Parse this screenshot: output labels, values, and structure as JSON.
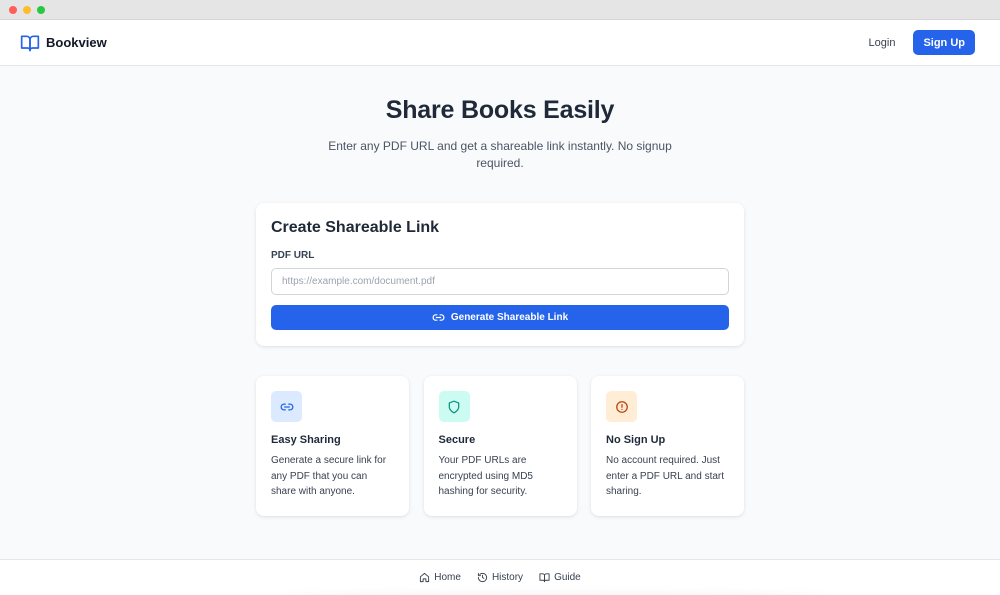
{
  "navbar": {
    "brand": "Bookview",
    "login_label": "Login",
    "signup_label": "Sign Up"
  },
  "hero": {
    "title": "Share Books Easily",
    "subtitle": "Enter any PDF URL and get a shareable link instantly. No signup required."
  },
  "form": {
    "title": "Create Shareable Link",
    "label": "PDF URL",
    "input_value": "",
    "input_placeholder": "https://example.com/document.pdf",
    "button_label": "Generate Shareable Link"
  },
  "features": [
    {
      "icon": "link-icon",
      "title": "Easy Sharing",
      "description": "Generate a secure link for any PDF that you can share with anyone.",
      "color": "#2563eb",
      "bg": "#dbeafe"
    },
    {
      "icon": "shield-icon",
      "title": "Secure",
      "description": "Your PDF URLs are encrypted using MD5 hashing for security.",
      "color": "#0d9488",
      "bg": "#ccfbf1"
    },
    {
      "icon": "alert-circle-icon",
      "title": "No Sign Up",
      "description": "No account required. Just enter a PDF URL and start sharing.",
      "color": "#c2410c",
      "bg": "#ffedd5"
    }
  ],
  "footer": {
    "links": [
      {
        "icon": "home-icon",
        "label": "Home"
      },
      {
        "icon": "history-icon",
        "label": "History"
      },
      {
        "icon": "book-icon",
        "label": "Guide"
      }
    ]
  },
  "colors": {
    "accent": "#2563eb",
    "background": "#f8fafc"
  }
}
